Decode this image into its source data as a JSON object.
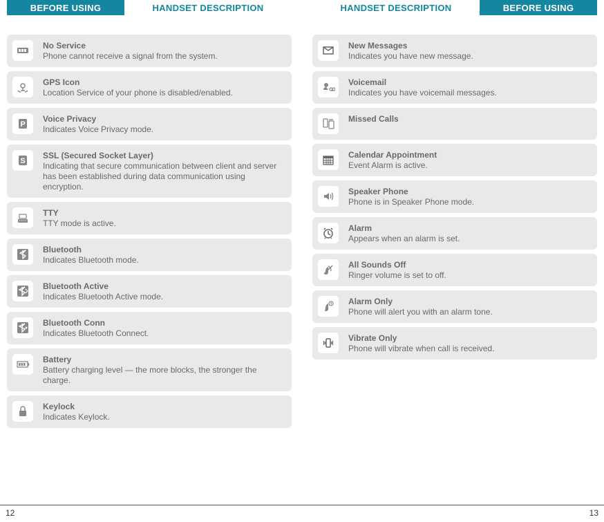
{
  "header": {
    "before_using": "BEFORE USING",
    "handset_description": "HANDSET DESCRIPTION"
  },
  "left": {
    "items": [
      {
        "icon": "no-service-icon",
        "title": "No Service",
        "desc": "Phone cannot receive a signal from the system."
      },
      {
        "icon": "gps-icon",
        "title": "GPS Icon",
        "desc": "Location Service of your phone is disabled/enabled."
      },
      {
        "icon": "voice-privacy-icon",
        "title": "Voice Privacy",
        "desc": "Indicates Voice Privacy mode."
      },
      {
        "icon": "ssl-icon",
        "title": "SSL (Secured Socket Layer)",
        "desc": "Indicating that secure communication between client and server has been established during data communication using encryption."
      },
      {
        "icon": "tty-icon",
        "title": "TTY",
        "desc": "TTY mode is active."
      },
      {
        "icon": "bluetooth-icon",
        "title": "Bluetooth",
        "desc": "Indicates Bluetooth mode."
      },
      {
        "icon": "bluetooth-active-icon",
        "title": "Bluetooth Active",
        "desc": "Indicates Bluetooth Active mode."
      },
      {
        "icon": "bluetooth-conn-icon",
        "title": "Bluetooth Conn",
        "desc": "Indicates Bluetooth Connect."
      },
      {
        "icon": "battery-icon",
        "title": "Battery",
        "desc": "Battery charging level — the more blocks, the stronger the charge."
      },
      {
        "icon": "keylock-icon",
        "title": "Keylock",
        "desc": "Indicates Keylock."
      }
    ]
  },
  "right": {
    "items": [
      {
        "icon": "new-messages-icon",
        "title": "New Messages",
        "desc": "Indicates you have new message."
      },
      {
        "icon": "voicemail-icon",
        "title": "Voicemail",
        "desc": "Indicates you have voicemail messages."
      },
      {
        "icon": "missed-calls-icon",
        "title": "Missed Calls",
        "desc": ""
      },
      {
        "icon": "calendar-icon",
        "title": "Calendar Appointment",
        "desc": "Event Alarm is active."
      },
      {
        "icon": "speaker-phone-icon",
        "title": "Speaker Phone",
        "desc": "Phone is in Speaker Phone mode."
      },
      {
        "icon": "alarm-icon",
        "title": "Alarm",
        "desc": "Appears when an alarm is set."
      },
      {
        "icon": "all-sounds-off-icon",
        "title": "All Sounds Off",
        "desc": "Ringer volume is set to off."
      },
      {
        "icon": "alarm-only-icon",
        "title": "Alarm Only",
        "desc": "Phone will alert you with an alarm tone."
      },
      {
        "icon": "vibrate-only-icon",
        "title": "Vibrate Only",
        "desc": "Phone will vibrate when call is received."
      }
    ]
  },
  "footer": {
    "left_page": "12",
    "right_page": "13"
  }
}
